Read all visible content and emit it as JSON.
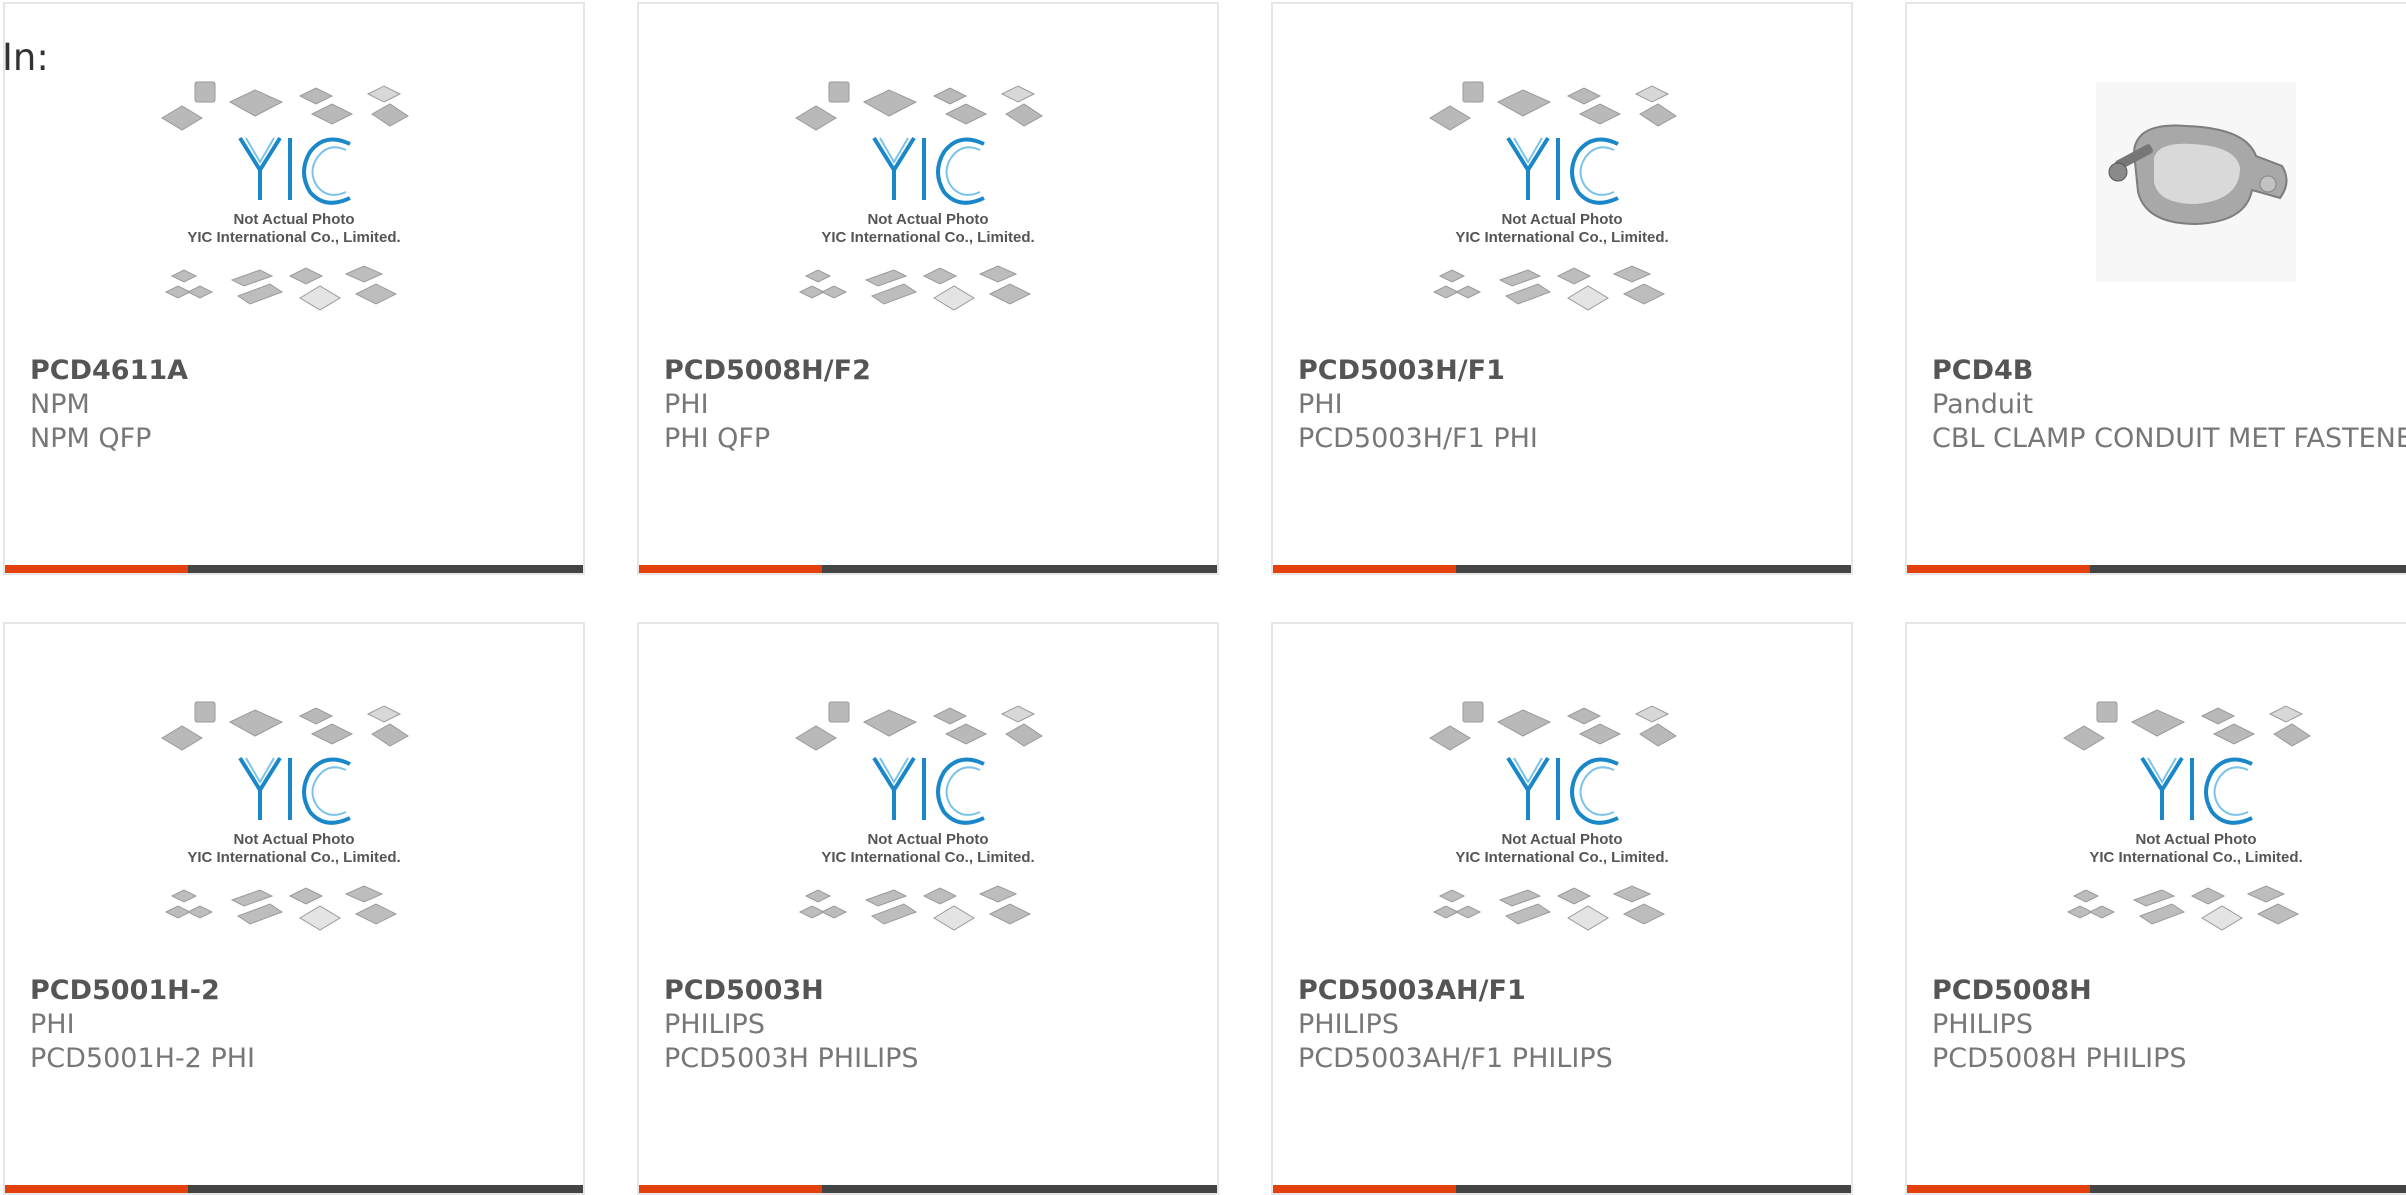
{
  "heading": "In:",
  "placeholder_image": {
    "caption_line1": "Not Actual Photo",
    "caption_line2": "YIC International Co., Limited.",
    "logo_text": "YIC"
  },
  "colors": {
    "accent": "#e2410b",
    "bar": "#444444",
    "logo": "#1a87c9"
  },
  "products": [
    {
      "part": "PCD4611A",
      "maker": "NPM",
      "desc": "NPM QFP",
      "image": "yic-placeholder"
    },
    {
      "part": "PCD5008H/F2",
      "maker": "PHI",
      "desc": "PHI QFP",
      "image": "yic-placeholder"
    },
    {
      "part": "PCD5003H/F1",
      "maker": "PHI",
      "desc": "PCD5003H/F1 PHI",
      "image": "yic-placeholder"
    },
    {
      "part": "PCD4B",
      "maker": "Panduit",
      "desc": "CBL CLAMP CONDUIT MET FASTENER",
      "image": "conduit-clamp-photo"
    },
    {
      "part": "PCD5001H-2",
      "maker": "PHI",
      "desc": "PCD5001H-2 PHI",
      "image": "yic-placeholder"
    },
    {
      "part": "PCD5003H",
      "maker": "PHILIPS",
      "desc": "PCD5003H PHILIPS",
      "image": "yic-placeholder"
    },
    {
      "part": "PCD5003AH/F1",
      "maker": "PHILIPS",
      "desc": "PCD5003AH/F1 PHILIPS",
      "image": "yic-placeholder"
    },
    {
      "part": "PCD5008H",
      "maker": "PHILIPS",
      "desc": "PCD5008H PHILIPS",
      "image": "yic-placeholder"
    }
  ]
}
